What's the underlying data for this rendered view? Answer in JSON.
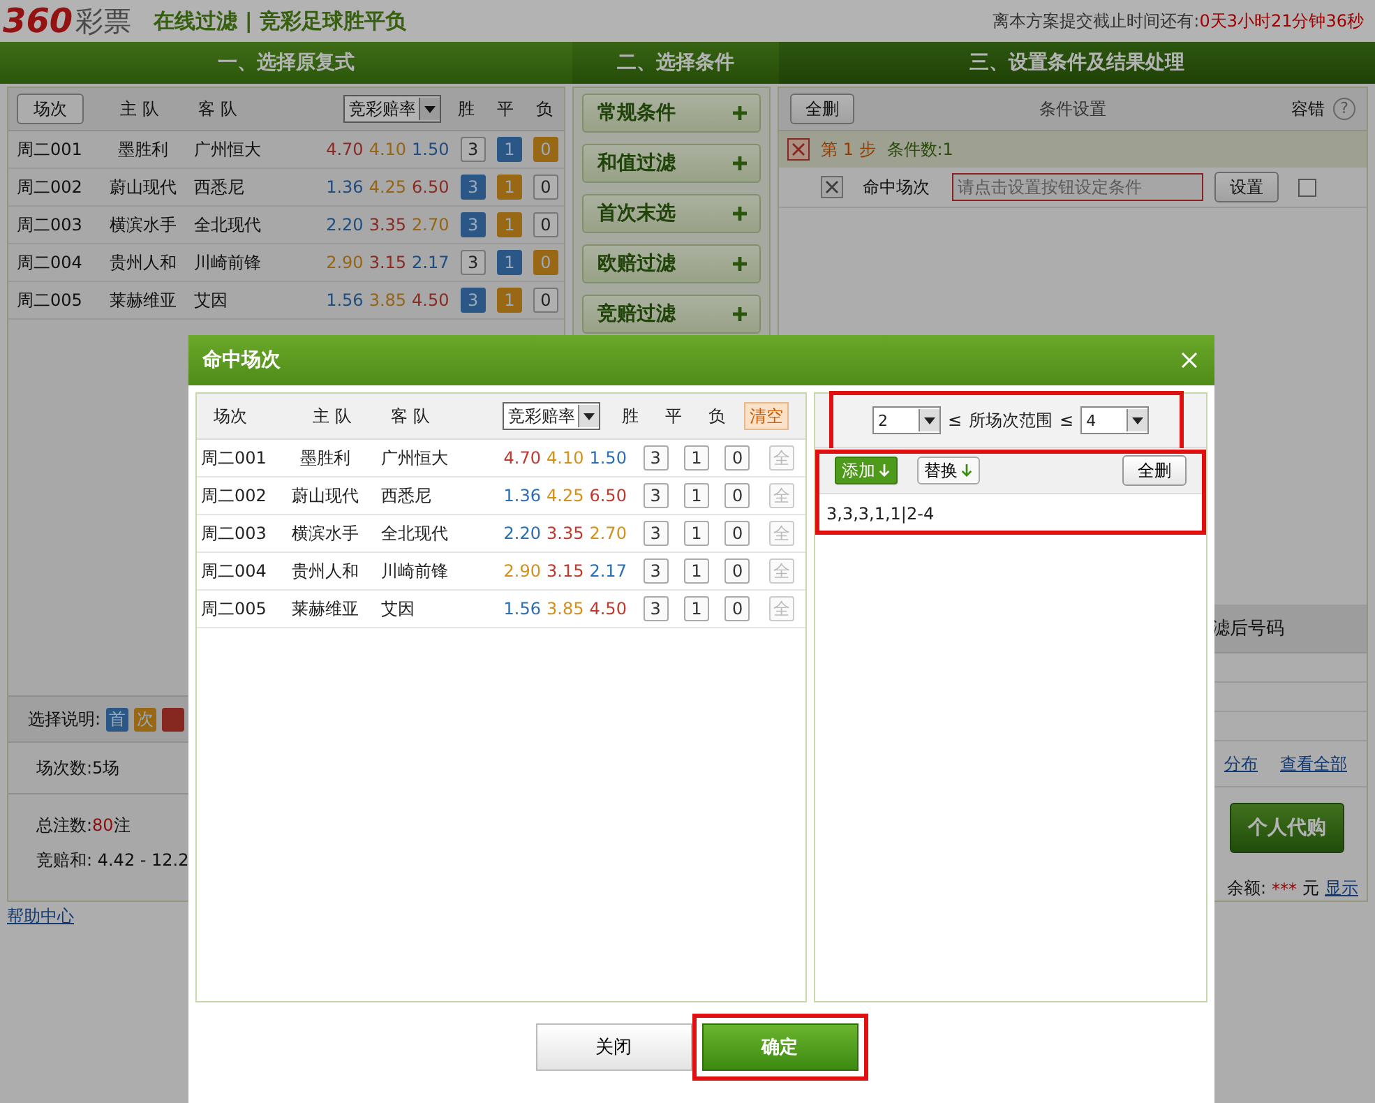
{
  "header": {
    "logo": "360",
    "logo_suffix": "彩票",
    "subtitle": "在线过滤 | 竞彩足球胜平负",
    "deadline_label": "离本方案提交截止时间还有:",
    "deadline": "0天3小时21分钟36秒"
  },
  "steps": [
    {
      "label": "一、选择原复式"
    },
    {
      "label": "二、选择条件"
    },
    {
      "label": "三、设置条件及结果处理"
    }
  ],
  "match_table": {
    "sort_button": "场次",
    "home_header": "主 队",
    "away_header": "客 队",
    "odds_select": "竞彩赔率",
    "result_headers": [
      "胜",
      "平",
      "负"
    ],
    "rows": [
      {
        "id": "周二001",
        "home": "墨胜利",
        "away": "广州恒大",
        "odds": [
          {
            "value": "4.70",
            "color": "#8a2a22"
          },
          {
            "value": "4.10",
            "color": "#956515"
          },
          {
            "value": "1.50",
            "color": "#1e4e80"
          }
        ],
        "picks": [
          {
            "label": "3",
            "selected": false
          },
          {
            "label": "1",
            "selected": true,
            "color": "#2a5786"
          },
          {
            "label": "0",
            "selected": true,
            "color": "#986815"
          }
        ]
      },
      {
        "id": "周二002",
        "home": "蔚山现代",
        "away": "西悉尼",
        "odds": [
          {
            "value": "1.36",
            "color": "#1e4e80"
          },
          {
            "value": "4.25",
            "color": "#956515"
          },
          {
            "value": "6.50",
            "color": "#8a2a22"
          }
        ],
        "picks": [
          {
            "label": "3",
            "selected": true,
            "color": "#2a5786"
          },
          {
            "label": "1",
            "selected": true,
            "color": "#986815"
          },
          {
            "label": "0",
            "selected": false
          }
        ]
      },
      {
        "id": "周二003",
        "home": "横滨水手",
        "away": "全北现代",
        "odds": [
          {
            "value": "2.20",
            "color": "#1e4e80"
          },
          {
            "value": "3.35",
            "color": "#8a2a22"
          },
          {
            "value": "2.70",
            "color": "#956515"
          }
        ],
        "picks": [
          {
            "label": "3",
            "selected": true,
            "color": "#2a5786"
          },
          {
            "label": "1",
            "selected": true,
            "color": "#986815"
          },
          {
            "label": "0",
            "selected": false
          }
        ]
      },
      {
        "id": "周二004",
        "home": "贵州人和",
        "away": "川崎前锋",
        "odds": [
          {
            "value": "2.90",
            "color": "#956515"
          },
          {
            "value": "3.15",
            "color": "#8a2a22"
          },
          {
            "value": "2.17",
            "color": "#1e4e80"
          }
        ],
        "picks": [
          {
            "label": "3",
            "selected": false
          },
          {
            "label": "1",
            "selected": true,
            "color": "#2a5786"
          },
          {
            "label": "0",
            "selected": true,
            "color": "#986815"
          }
        ]
      },
      {
        "id": "周二005",
        "home": "莱赫维亚",
        "away": "艾因",
        "odds": [
          {
            "value": "1.56",
            "color": "#1e4e80"
          },
          {
            "value": "3.85",
            "color": "#956515"
          },
          {
            "value": "4.50",
            "color": "#8a2a22"
          }
        ],
        "picks": [
          {
            "label": "3",
            "selected": true,
            "color": "#2a5786"
          },
          {
            "label": "1",
            "selected": true,
            "color": "#986815"
          },
          {
            "label": "0",
            "selected": false
          }
        ]
      }
    ]
  },
  "legend": {
    "label": "选择说明:",
    "items": [
      {
        "label": "首",
        "color": "#2a5786"
      },
      {
        "label": "次",
        "color": "#986815"
      },
      {
        "color": "#862820"
      }
    ]
  },
  "summary": {
    "matches_label": "场次数:",
    "matches": "5场",
    "bets_label": "总注数:",
    "bets": "80",
    "bets_unit": "注",
    "odds_sum_label": "竞赔和:",
    "odds_sum": "4.42 - 12.2"
  },
  "help_link": "帮助中心",
  "filters": [
    {
      "label": "常规条件"
    },
    {
      "label": "和值过滤"
    },
    {
      "label": "首次末选"
    },
    {
      "label": "欧赔过滤"
    },
    {
      "label": "竞赔过滤"
    }
  ],
  "conditions": {
    "delete_all": "全删",
    "title": "条件设置",
    "tolerance": "容错",
    "help": "?",
    "step": "第 1 步",
    "count": "条件数:1",
    "items": [
      {
        "name": "命中场次",
        "placeholder": "请点击设置按钮设定条件",
        "button": "设置",
        "checked": false
      }
    ]
  },
  "results": {
    "header": "滤后号码",
    "links": [
      "分布",
      "查看全部"
    ],
    "buy_button": "个人代购",
    "balance_label": "余额:",
    "balance": "***",
    "balance_unit": "元",
    "show_link": "显示"
  },
  "dialog": {
    "title": "命中场次",
    "table": {
      "id_header": "场次",
      "home_header": "主 队",
      "away_header": "客 队",
      "odds_select": "竞彩赔率",
      "result_headers": [
        "胜",
        "平",
        "负"
      ],
      "clear_button": "清空",
      "rows": [
        {
          "id": "周二001",
          "home": "墨胜利",
          "away": "广州恒大",
          "odds": [
            {
              "value": "4.70",
              "color": "#c0392b"
            },
            {
              "value": "4.10",
              "color": "#d4901a"
            },
            {
              "value": "1.50",
              "color": "#2a6fb5"
            }
          ],
          "picks": [
            "3",
            "1",
            "0"
          ],
          "all_button": {
            "label": "全",
            "disabled": true
          }
        },
        {
          "id": "周二002",
          "home": "蔚山现代",
          "away": "西悉尼",
          "odds": [
            {
              "value": "1.36",
              "color": "#2a6fb5"
            },
            {
              "value": "4.25",
              "color": "#d4901a"
            },
            {
              "value": "6.50",
              "color": "#c0392b"
            }
          ],
          "picks": [
            "3",
            "1",
            "0"
          ],
          "all_button": {
            "label": "全",
            "disabled": true
          }
        },
        {
          "id": "周二003",
          "home": "横滨水手",
          "away": "全北现代",
          "odds": [
            {
              "value": "2.20",
              "color": "#2a6fb5"
            },
            {
              "value": "3.35",
              "color": "#c0392b"
            },
            {
              "value": "2.70",
              "color": "#d4901a"
            }
          ],
          "picks": [
            "3",
            "1",
            "0"
          ],
          "all_button": {
            "label": "全",
            "disabled": true
          }
        },
        {
          "id": "周二004",
          "home": "贵州人和",
          "away": "川崎前锋",
          "odds": [
            {
              "value": "2.90",
              "color": "#d4901a"
            },
            {
              "value": "3.15",
              "color": "#c0392b"
            },
            {
              "value": "2.17",
              "color": "#2a6fb5"
            }
          ],
          "picks": [
            "3",
            "1",
            "0"
          ],
          "all_button": {
            "label": "全",
            "disabled": true
          }
        },
        {
          "id": "周二005",
          "home": "莱赫维亚",
          "away": "艾因",
          "odds": [
            {
              "value": "1.56",
              "color": "#2a6fb5"
            },
            {
              "value": "3.85",
              "color": "#d4901a"
            },
            {
              "value": "4.50",
              "color": "#c0392b"
            }
          ],
          "picks": [
            "3",
            "1",
            "0"
          ],
          "all_button": {
            "label": "全",
            "disabled": true
          }
        }
      ]
    },
    "range": {
      "min": "2",
      "op_left": "≤",
      "label": "所场次范围",
      "op_right": "≤",
      "max": "4"
    },
    "add_button": "添加",
    "replace_button": "替换",
    "delete_all": "全删",
    "result": "3,3,3,1,1|2-4",
    "close_button": "关闭",
    "ok_button": "确定"
  }
}
